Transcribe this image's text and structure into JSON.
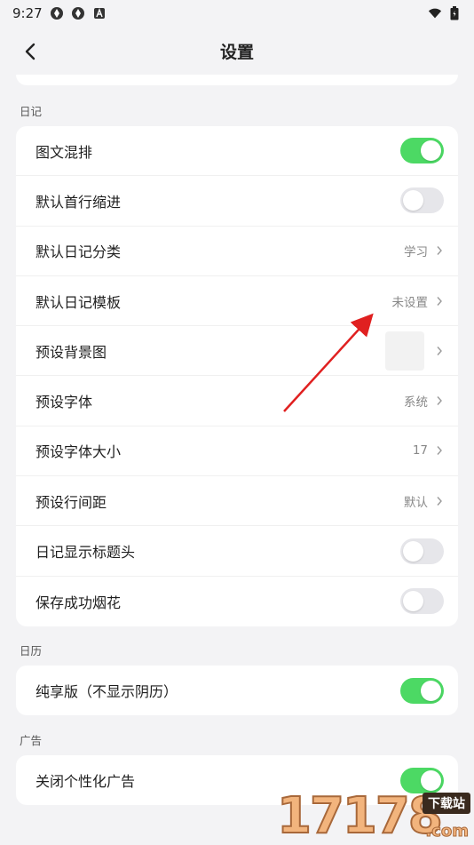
{
  "status_bar": {
    "time": "9:27"
  },
  "header": {
    "title": "设置"
  },
  "sections": {
    "diary": {
      "label": "日记",
      "rows": [
        {
          "label": "图文混排",
          "toggle": "on"
        },
        {
          "label": "默认首行缩进",
          "toggle": "off"
        },
        {
          "label": "默认日记分类",
          "value": "学习"
        },
        {
          "label": "默认日记模板",
          "value": "未设置"
        },
        {
          "label": "预设背景图"
        },
        {
          "label": "预设字体",
          "value": "系统"
        },
        {
          "label": "预设字体大小",
          "value": "17"
        },
        {
          "label": "预设行间距",
          "value": "默认"
        },
        {
          "label": "日记显示标题头",
          "toggle": "off"
        },
        {
          "label": "保存成功烟花",
          "toggle": "off"
        }
      ]
    },
    "calendar": {
      "label": "日历",
      "rows": [
        {
          "label": "纯享版（不显示阴历）",
          "toggle": "on"
        }
      ]
    },
    "ads": {
      "label": "广告",
      "rows": [
        {
          "label": "关闭个性化广告",
          "toggle": "on"
        }
      ]
    }
  },
  "watermark": {
    "digits": "17178",
    "tag": "下载站",
    "domain": ".com"
  },
  "colors": {
    "toggle_on": "#4cd964",
    "toggle_off": "#e6e6ea",
    "annotation_arrow": "#e02020"
  }
}
